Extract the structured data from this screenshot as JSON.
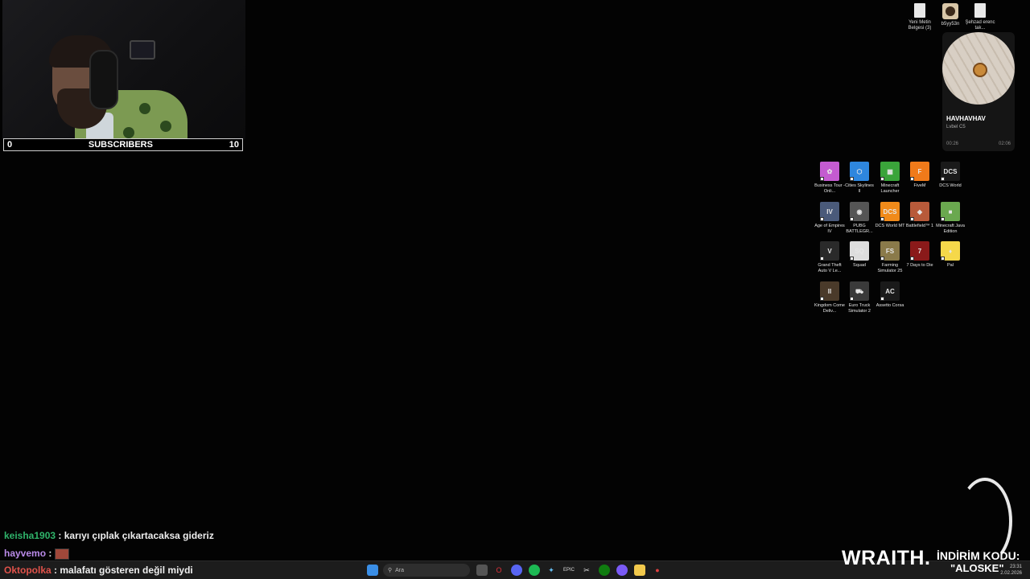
{
  "webcam": {
    "subscribers": {
      "left": "0",
      "label": "SUBSCRIBERS",
      "right": "10"
    }
  },
  "top_icons": [
    {
      "label": "Yeni Metin Belgesi (3)"
    },
    {
      "label": "b5yy53n"
    },
    {
      "label": "Şehzad erenc tak..."
    }
  ],
  "music": {
    "song": "HAVHAVHAV",
    "artist": "Lvbel C5",
    "elapsed": "00:26",
    "duration": "02:06"
  },
  "desktop_icons": [
    {
      "label": "Business Tour - Onli...",
      "color": "#c45bd0",
      "glyph": "✿"
    },
    {
      "label": "Cities Skylines II",
      "color": "#2e86de",
      "glyph": "⬡"
    },
    {
      "label": "Minecraft Launcher",
      "color": "#3aa43a",
      "glyph": "▦"
    },
    {
      "label": "FiveM",
      "color": "#f07a1a",
      "glyph": "F"
    },
    {
      "label": "DCS World",
      "color": "#1a1a1a",
      "glyph": "DCS"
    },
    {
      "label": "Age of Empires IV",
      "color": "#4a5a7a",
      "glyph": "IV"
    },
    {
      "label": "PUBG BATTLEGR...",
      "color": "#555",
      "glyph": "◉"
    },
    {
      "label": "DCS World MT",
      "color": "#f08a1a",
      "glyph": "DCS"
    },
    {
      "label": "Battlefield™ 1",
      "color": "#b85a3a",
      "glyph": "◆"
    },
    {
      "label": "Minecraft Java Edition",
      "color": "#6aa84f",
      "glyph": "■"
    },
    {
      "label": "Grand Theft Auto V Le...",
      "color": "#2a2a2a",
      "glyph": "V"
    },
    {
      "label": "Squad",
      "color": "#ddd",
      "glyph": "SQ"
    },
    {
      "label": "Farming Simulator 25",
      "color": "#8a7a4a",
      "glyph": "FS"
    },
    {
      "label": "7 Days to Die",
      "color": "#8a1a1a",
      "glyph": "7"
    },
    {
      "label": "Pal",
      "color": "#f5d84a",
      "glyph": "♦"
    },
    {
      "label": "Kingdom Come Deliv...",
      "color": "#4a3a2a",
      "glyph": "II"
    },
    {
      "label": "Euro Truck Simulator 2",
      "color": "#3a3a3a",
      "glyph": "⛟"
    },
    {
      "label": "Assetto Corsa",
      "color": "#1a1a1a",
      "glyph": "AC"
    }
  ],
  "chat": [
    {
      "user": "keisha1903",
      "user_color": "#2fb36a",
      "message": ": karıyı çıplak çıkartacaksa gideriz"
    },
    {
      "user": "hayvemo",
      "user_color": "#b98ae8",
      "message": ":"
    },
    {
      "user": "Oktopolka",
      "user_color": "#e0524a",
      "message": ": malafatı gösteren değil miydi"
    }
  ],
  "taskbar": {
    "search_placeholder": "Ara",
    "clock_time": "23:31",
    "clock_date": "2.02.2026"
  },
  "sponsor": {
    "brand": "WRAITH.",
    "code_label": "İNDİRİM KODU:",
    "code": "\"ALOSKE\""
  }
}
